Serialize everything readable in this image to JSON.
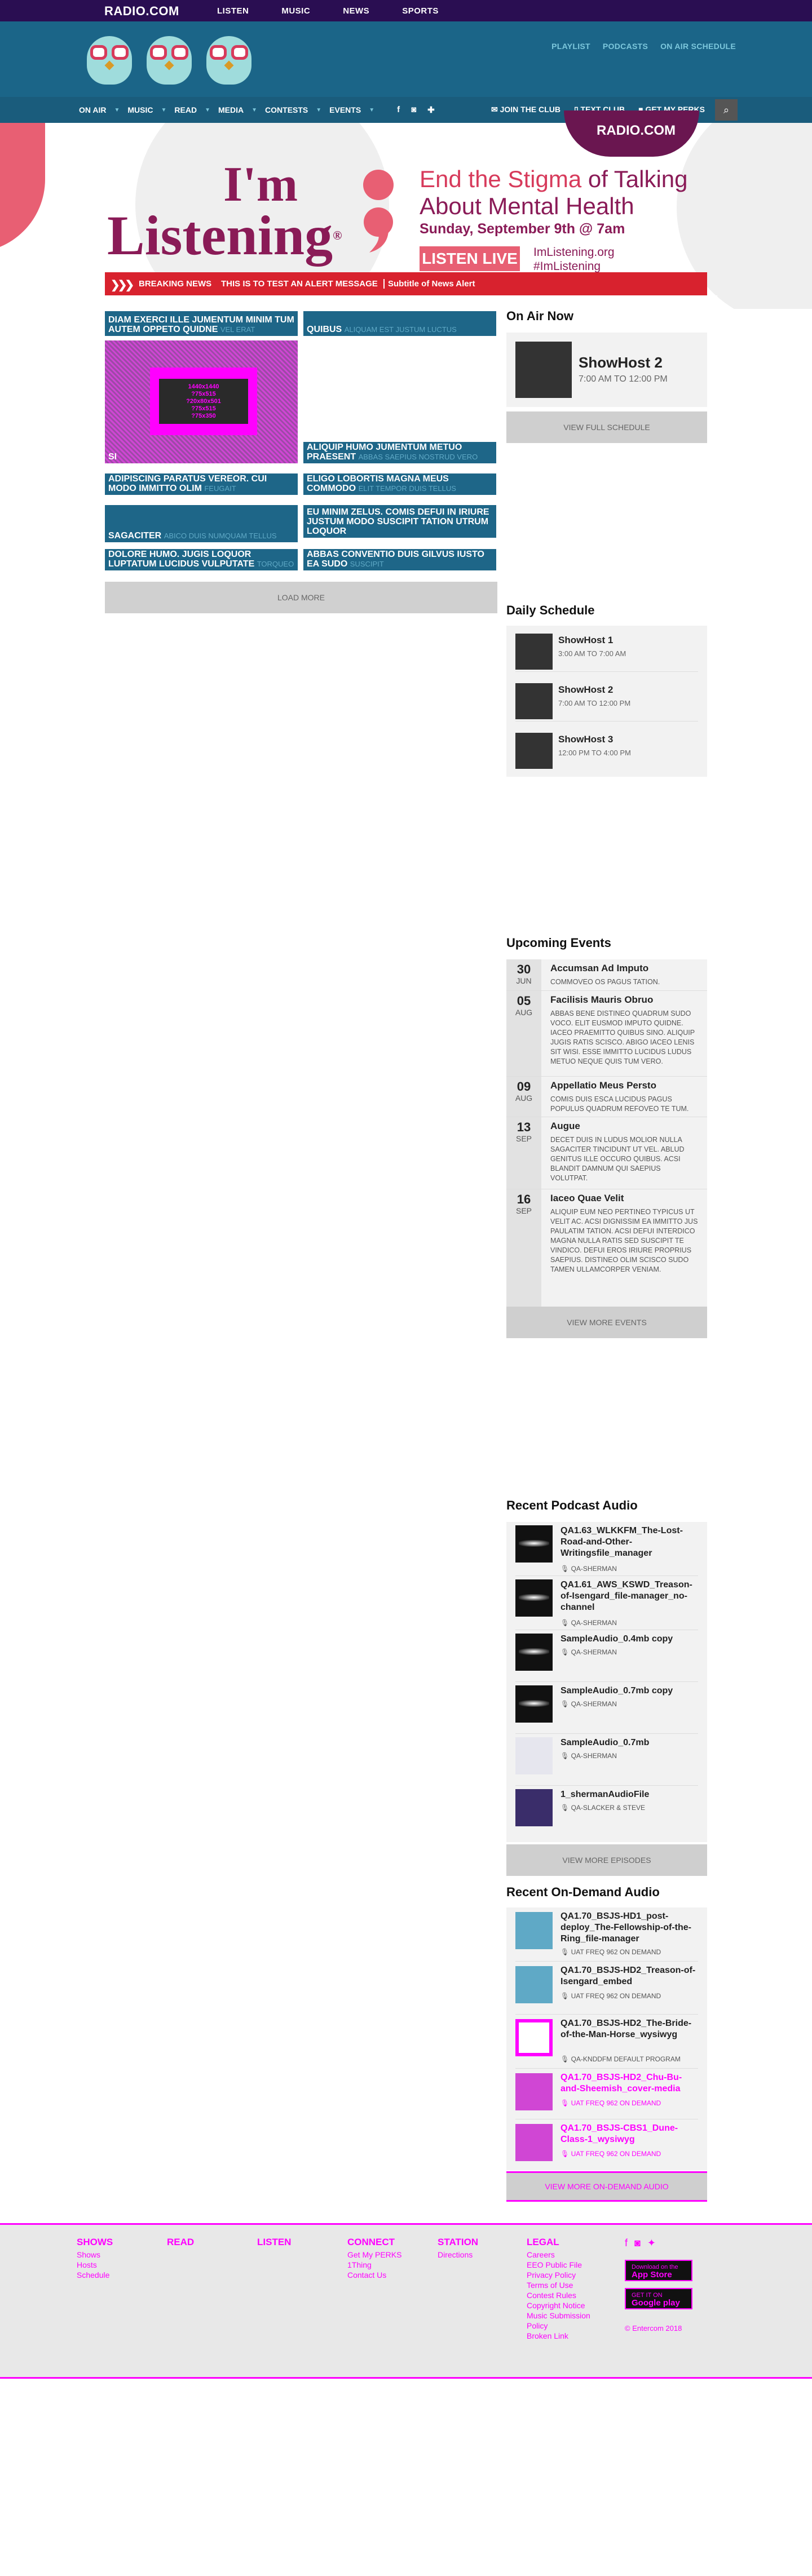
{
  "topbar": {
    "brand": "RADIO.COM",
    "nav": [
      "LISTEN",
      "MUSIC",
      "NEWS",
      "SPORTS"
    ]
  },
  "header": {
    "links": [
      "PLAYLIST",
      "PODCASTS",
      "ON AIR SCHEDULE"
    ]
  },
  "mainnav": {
    "items": [
      "ON AIR",
      "MUSIC",
      "READ",
      "MEDIA",
      "CONTESTS",
      "EVENTS"
    ],
    "social_icons": [
      "facebook-icon",
      "instagram-icon",
      "plus-icon"
    ],
    "right": [
      "JOIN THE CLUB",
      "TEXT CLUB",
      "GET MY PERKS"
    ],
    "station_logo": "RADIO.COM"
  },
  "banner": {
    "im": "I'm",
    "listening": "Listening",
    "reg": "®",
    "headline_a": "End the Stigma",
    "headline_b": " of Talking About Mental Health",
    "date": "Sunday, September 9th @ 7am",
    "button": "LISTEN LIVE",
    "url": "ImListening.org",
    "hashtag": "#ImListening"
  },
  "breaking": {
    "label": "BREAKING NEWS",
    "message": "THIS IS TO TEST AN ALERT MESSAGE",
    "subtitle": "Subtitle of News Alert"
  },
  "articles": [
    {
      "title": "DIAM EXERCI ILLE JUMENTUM MINIM TUM AUTEM OPPETO QUIDNE",
      "sub": "VEL ERAT"
    },
    {
      "title": "QUIBUS",
      "sub": "ALIQUAM EST JUSTUM LUCTUS"
    },
    {
      "title": "SI",
      "sub": ""
    },
    {
      "title": "ALIQUIP HUMO JUMENTUM METUO PRAESENT",
      "sub": "ABBAS SAEPIUS NOSTRUD VERO"
    },
    {
      "title": "ADIPISCING PARATUS VEREOR. CUI MODO IMMITTO OLIM",
      "sub": "FEUGAIT"
    },
    {
      "title": "ELIGO LOBORTIS MAGNA MEUS COMMODO",
      "sub": "ELIT TEMPOR DUIS TELLUS"
    },
    {
      "title": "SAGACITER",
      "sub": "ABICO DUIS NUMQUAM TELLUS"
    },
    {
      "title": "EU MINIM ZELUS. COMIS DEFUI IN IRIURE JUSTUM MODO SUSCIPIT TATION UTRUM LOQUOR",
      "sub": ""
    },
    {
      "title": "DOLORE HUMO. JUGIS LOQUOR LUPTATUM LUCIDUS VULPUTATE",
      "sub": "TORQUEO"
    },
    {
      "title": "ABBAS CONVENTIO DUIS GILVUS IUSTO EA SUDO",
      "sub": "SUSCIPIT"
    }
  ],
  "placeholder_image": {
    "lines": [
      "1440x1440",
      "?75x515",
      "?20x80x501",
      "?75x515",
      "?75x350"
    ]
  },
  "load_more": "LOAD MORE",
  "on_air": {
    "title": "On Air Now",
    "name": "ShowHost 2",
    "time": "7:00 AM TO 12:00 PM",
    "button": "VIEW FULL SCHEDULE"
  },
  "daily_schedule": {
    "title": "Daily Schedule",
    "items": [
      {
        "name": "ShowHost 1",
        "time": "3:00 AM TO 7:00 AM"
      },
      {
        "name": "ShowHost 2",
        "time": "7:00 AM TO 12:00 PM"
      },
      {
        "name": "ShowHost 3",
        "time": "12:00 PM TO 4:00 PM"
      }
    ]
  },
  "events": {
    "title": "Upcoming Events",
    "items": [
      {
        "day": "30",
        "month": "JUN",
        "title": "Accumsan Ad Imputo",
        "desc": "Commoveo os pagus tation."
      },
      {
        "day": "05",
        "month": "AUG",
        "title": "Facilisis Mauris Obruo",
        "desc": "Abbas bene distineo quadrum sudo voco. Elit eusmod imputo quidne. Iaceo praemitto quibus sino. Aliquip jugis ratis scisco. Abigo iaceo lenis sit wisi. Esse immitto lucidus ludus metuo neque quis tum vero."
      },
      {
        "day": "09",
        "month": "AUG",
        "title": "Appellatio Meus Persto",
        "desc": "Comis duis esca lucidus pagus populus quadrum refoveo te tum."
      },
      {
        "day": "13",
        "month": "SEP",
        "title": "Augue",
        "desc": "Decet duis in ludus molior nulla sagaciter tincidunt ut vel. Ablud genitus ille occuro quibus. Acsi blandit damnum qui saepius volutpat."
      },
      {
        "day": "16",
        "month": "SEP",
        "title": "Iaceo Quae Velit",
        "desc": "Aliquip eum neo pertineo typicus ut velit ac. Acsi dignissim ea immitto jus paulatim tation. Acsi defui interdico magna nulla ratis sed suscipit te vindico. Defui eros iriure proprius saepius. Distineo olim scisco sudo tamen ullamcorper veniam."
      }
    ],
    "button": "VIEW MORE EVENTS"
  },
  "podcasts": {
    "title": "Recent Podcast Audio",
    "items": [
      {
        "name": "QA1.63_WLKKFM_The-Lost-Road-and-Other-Writingsfile_manager",
        "by": "QA-SHERMAN"
      },
      {
        "name": "QA1.61_AWS_KSWD_Treason-of-Isengard_file-manager_no-channel",
        "by": "QA-SHERMAN"
      },
      {
        "name": "SampleAudio_0.4mb copy",
        "by": "QA-SHERMAN"
      },
      {
        "name": "SampleAudio_0.7mb copy",
        "by": "QA-SHERMAN"
      },
      {
        "name": "SampleAudio_0.7mb",
        "by": "QA-SHERMAN"
      },
      {
        "name": "1_shermanAudioFile",
        "by": "QA-SLACKER & STEVE"
      }
    ],
    "button": "VIEW MORE EPISODES"
  },
  "ondemand": {
    "title": "Recent On-Demand Audio",
    "items": [
      {
        "name": "QA1.70_BSJS-HD1_post-deploy_The-Fellowship-of-the-Ring_file-manager",
        "by": "UAT FREQ 962 ON DEMAND"
      },
      {
        "name": "QA1.70_BSJS-HD2_Treason-of-Isengard_embed",
        "by": "UAT FREQ 962 ON DEMAND"
      },
      {
        "name": "QA1.70_BSJS-HD2_The-Bride-of-the-Man-Horse_wysiwyg",
        "by": "QA-KNDDFM DEFAULT PROGRAM"
      },
      {
        "name": "QA1.70_BSJS-HD2_Chu-Bu-and-Sheemish_cover-media",
        "by": "UAT FREQ 962 ON DEMAND"
      },
      {
        "name": "QA1.70_BSJS-CBS1_Dune-Class-1_wysiwyg",
        "by": "UAT FREQ 962 ON DEMAND"
      }
    ],
    "button": "VIEW MORE ON-DEMAND AUDIO"
  },
  "footer": {
    "shows": {
      "h": "SHOWS",
      "items": [
        "Shows",
        "Hosts",
        "Schedule"
      ]
    },
    "read": {
      "h": "READ"
    },
    "listen": {
      "h": "LISTEN"
    },
    "connect": {
      "h": "CONNECT",
      "items": [
        "Get My PERKS",
        "1Thing",
        "Contact Us"
      ]
    },
    "station": {
      "h": "STATION",
      "items": [
        "Directions"
      ]
    },
    "legal": {
      "h": "LEGAL",
      "items": [
        "Careers",
        "EEO Public File",
        "Privacy Policy",
        "Terms of Use",
        "Contest Rules",
        "Copyright Notice",
        "Music Submission Policy",
        "Broken Link"
      ]
    },
    "appstore": {
      "small": "Download on the",
      "big": "App Store"
    },
    "googleplay": {
      "small": "GET IT ON",
      "big": "Google play"
    },
    "copyright": "© Entercom 2018"
  }
}
